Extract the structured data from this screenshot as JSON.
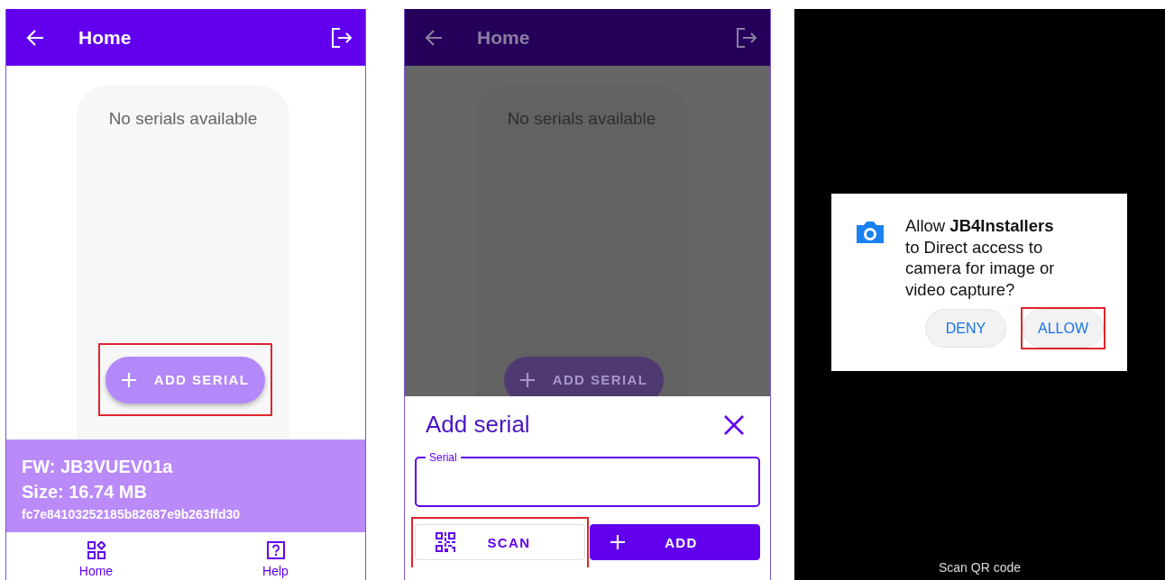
{
  "home_screen": {
    "app_bar": {
      "title": "Home"
    },
    "empty_message": "No serials available",
    "add_button": {
      "label": "ADD SERIAL",
      "highlighted": true
    },
    "firmware": {
      "name": "FW: JB3VUEV01a",
      "size": "Size: 16.74 MB",
      "hash": "fc7e84103252185b82687e9b263ffd30"
    },
    "bottom_nav": [
      {
        "label": "Home",
        "kind": "home"
      },
      {
        "label": "Help",
        "kind": "help"
      }
    ]
  },
  "add_serial_screen": {
    "dimmed": true,
    "app_bar": {
      "title": "Home"
    },
    "empty_message": "No serials available",
    "add_button": {
      "label": "ADD SERIAL",
      "highlighted": false
    },
    "sheet": {
      "title": "Add serial",
      "field": {
        "label": "Serial"
      },
      "buttons": [
        {
          "kind": "outlined",
          "label": "SCAN",
          "highlighted": true
        },
        {
          "kind": "filled",
          "label": "ADD",
          "highlighted": false
        }
      ]
    }
  },
  "permission_screen": {
    "dialog": {
      "message": "Allow **JB4Installers** to Direct access to camera for image or video capture?",
      "buttons": [
        {
          "label": "DENY",
          "highlighted": false
        },
        {
          "label": "ALLOW",
          "highlighted": true
        }
      ]
    },
    "caption": "Scan QR code"
  }
}
